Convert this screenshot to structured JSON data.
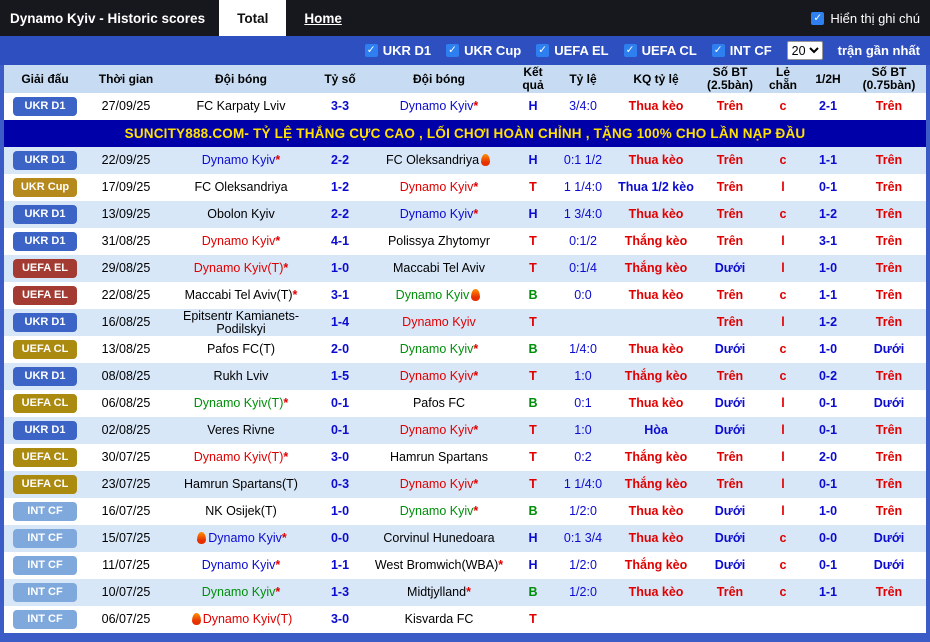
{
  "window": {
    "title": "Dynamo Kyiv - Historic scores"
  },
  "tabs": [
    {
      "label": "Total",
      "active": true
    },
    {
      "label": "Home",
      "active": false
    }
  ],
  "show_notes": {
    "label": "Hiển thị ghi chú",
    "checked": true
  },
  "filters": {
    "leagues": [
      {
        "label": "UKR D1",
        "checked": true
      },
      {
        "label": "UKR Cup",
        "checked": true
      },
      {
        "label": "UEFA EL",
        "checked": true
      },
      {
        "label": "UEFA CL",
        "checked": true
      },
      {
        "label": "INT CF",
        "checked": true
      }
    ],
    "count_value": "20",
    "count_suffix": "trận gần nhất"
  },
  "ad": {
    "text": "SUNCITY888.COM- TỶ LỆ THẮNG CỰC CAO , LỐI CHƠI HOÀN CHỈNH , TẶNG 100% CHO LẦN NẠP ĐẦU"
  },
  "colors": {
    "win_red": "#e10000",
    "draw_blue": "#0b0bd0",
    "loss_green": "#008f0a",
    "frame_blue": "#3b5cc6",
    "filter_bar_blue": "#2e4fc0",
    "header_bg": "#c7dcf2",
    "row_alt_bg": "#d8e7f8",
    "ad_bg": "#0000a8",
    "ad_text": "#ffe000",
    "leagues": {
      "ukrd1": "#3c63c6",
      "ukrcup": "#b5891b",
      "uefael": "#a43b32",
      "uefacl": "#ab8a10",
      "intcf": "#7fa9dc"
    }
  },
  "table": {
    "headers": [
      "Giải đấu",
      "Thời gian",
      "Đội bóng",
      "Tỷ số",
      "Đội bóng",
      "Kết quả",
      "Tỷ lệ",
      "KQ tỷ lệ",
      "Số BT (2.5bàn)",
      "Lẻ chẵn",
      "1/2H",
      "Số BT (0.75bàn)"
    ],
    "rows": [
      {
        "league": {
          "label": "UKR D1",
          "key": "ukrd1"
        },
        "date": "27/09/25",
        "home": {
          "name": "FC Karpaty Lviv",
          "color": "black",
          "star": false,
          "fire": null
        },
        "score": "3-3",
        "away": {
          "name": "Dynamo Kyiv",
          "color": "blue",
          "star": true,
          "fire": null
        },
        "result": {
          "text": "H",
          "color": "blue"
        },
        "handicap": "3/4:0",
        "handicap_result": {
          "text": "Thua kèo",
          "color": "red"
        },
        "goals25": {
          "text": "Trên",
          "color": "red"
        },
        "odd_even": {
          "text": "c",
          "color": "red"
        },
        "half_score": "2-1",
        "goals075": {
          "text": "Trên",
          "color": "red"
        }
      },
      {
        "league": {
          "label": "UKR D1",
          "key": "ukrd1"
        },
        "date": "22/09/25",
        "home": {
          "name": "Dynamo Kyiv",
          "color": "blue",
          "star": true,
          "fire": null
        },
        "score": "2-2",
        "away": {
          "name": "FC Oleksandriya",
          "color": "black",
          "star": false,
          "fire": "after"
        },
        "result": {
          "text": "H",
          "color": "blue"
        },
        "handicap": "0:1 1/2",
        "handicap_result": {
          "text": "Thua kèo",
          "color": "red"
        },
        "goals25": {
          "text": "Trên",
          "color": "red"
        },
        "odd_even": {
          "text": "c",
          "color": "red"
        },
        "half_score": "1-1",
        "goals075": {
          "text": "Trên",
          "color": "red"
        }
      },
      {
        "league": {
          "label": "UKR Cup",
          "key": "ukrcup"
        },
        "date": "17/09/25",
        "home": {
          "name": "FC Oleksandriya",
          "color": "black",
          "star": false,
          "fire": null
        },
        "score": "1-2",
        "away": {
          "name": "Dynamo Kyiv",
          "color": "red",
          "star": true,
          "fire": null
        },
        "result": {
          "text": "T",
          "color": "red"
        },
        "handicap": "1 1/4:0",
        "handicap_result": {
          "text": "Thua 1/2 kèo",
          "color": "blue"
        },
        "goals25": {
          "text": "Trên",
          "color": "red"
        },
        "odd_even": {
          "text": "l",
          "color": "red"
        },
        "half_score": "0-1",
        "goals075": {
          "text": "Trên",
          "color": "red"
        }
      },
      {
        "league": {
          "label": "UKR D1",
          "key": "ukrd1"
        },
        "date": "13/09/25",
        "home": {
          "name": "Obolon Kyiv",
          "color": "black",
          "star": false,
          "fire": null
        },
        "score": "2-2",
        "away": {
          "name": "Dynamo Kyiv",
          "color": "blue",
          "star": true,
          "fire": null
        },
        "result": {
          "text": "H",
          "color": "blue"
        },
        "handicap": "1 3/4:0",
        "handicap_result": {
          "text": "Thua kèo",
          "color": "red"
        },
        "goals25": {
          "text": "Trên",
          "color": "red"
        },
        "odd_even": {
          "text": "c",
          "color": "red"
        },
        "half_score": "1-2",
        "goals075": {
          "text": "Trên",
          "color": "red"
        }
      },
      {
        "league": {
          "label": "UKR D1",
          "key": "ukrd1"
        },
        "date": "31/08/25",
        "home": {
          "name": "Dynamo Kyiv",
          "color": "red",
          "star": true,
          "fire": null
        },
        "score": "4-1",
        "away": {
          "name": "Polissya Zhytomyr",
          "color": "black",
          "star": false,
          "fire": null
        },
        "result": {
          "text": "T",
          "color": "red"
        },
        "handicap": "0:1/2",
        "handicap_result": {
          "text": "Thắng kèo",
          "color": "red"
        },
        "goals25": {
          "text": "Trên",
          "color": "red"
        },
        "odd_even": {
          "text": "l",
          "color": "red"
        },
        "half_score": "3-1",
        "goals075": {
          "text": "Trên",
          "color": "red"
        }
      },
      {
        "league": {
          "label": "UEFA EL",
          "key": "uefael"
        },
        "date": "29/08/25",
        "home": {
          "name": "Dynamo Kyiv(T)",
          "color": "red",
          "star": true,
          "fire": null
        },
        "score": "1-0",
        "away": {
          "name": "Maccabi Tel Aviv",
          "color": "black",
          "star": false,
          "fire": null
        },
        "result": {
          "text": "T",
          "color": "red"
        },
        "handicap": "0:1/4",
        "handicap_result": {
          "text": "Thắng kèo",
          "color": "red"
        },
        "goals25": {
          "text": "Dưới",
          "color": "blue"
        },
        "odd_even": {
          "text": "l",
          "color": "red"
        },
        "half_score": "1-0",
        "goals075": {
          "text": "Trên",
          "color": "red"
        }
      },
      {
        "league": {
          "label": "UEFA EL",
          "key": "uefael"
        },
        "date": "22/08/25",
        "home": {
          "name": "Maccabi Tel Aviv(T)",
          "color": "black",
          "star": true,
          "fire": null
        },
        "score": "3-1",
        "away": {
          "name": "Dynamo Kyiv",
          "color": "green",
          "star": false,
          "fire": "after"
        },
        "result": {
          "text": "B",
          "color": "green"
        },
        "handicap": "0:0",
        "handicap_result": {
          "text": "Thua kèo",
          "color": "red"
        },
        "goals25": {
          "text": "Trên",
          "color": "red"
        },
        "odd_even": {
          "text": "c",
          "color": "red"
        },
        "half_score": "1-1",
        "goals075": {
          "text": "Trên",
          "color": "red"
        }
      },
      {
        "league": {
          "label": "UKR D1",
          "key": "ukrd1"
        },
        "date": "16/08/25",
        "home": {
          "name": "Epitsentr Kamianets-Podilskyi",
          "color": "black",
          "star": false,
          "fire": null
        },
        "score": "1-4",
        "away": {
          "name": "Dynamo Kyiv",
          "color": "red",
          "star": false,
          "fire": null
        },
        "result": {
          "text": "T",
          "color": "red"
        },
        "handicap": "",
        "handicap_result": {
          "text": "",
          "color": "red"
        },
        "goals25": {
          "text": "Trên",
          "color": "red"
        },
        "odd_even": {
          "text": "l",
          "color": "red"
        },
        "half_score": "1-2",
        "goals075": {
          "text": "Trên",
          "color": "red"
        }
      },
      {
        "league": {
          "label": "UEFA CL",
          "key": "uefacl"
        },
        "date": "13/08/25",
        "home": {
          "name": "Pafos FC(T)",
          "color": "black",
          "star": false,
          "fire": null
        },
        "score": "2-0",
        "away": {
          "name": "Dynamo Kyiv",
          "color": "green",
          "star": true,
          "fire": null
        },
        "result": {
          "text": "B",
          "color": "green"
        },
        "handicap": "1/4:0",
        "handicap_result": {
          "text": "Thua kèo",
          "color": "red"
        },
        "goals25": {
          "text": "Dưới",
          "color": "blue"
        },
        "odd_even": {
          "text": "c",
          "color": "red"
        },
        "half_score": "1-0",
        "goals075": {
          "text": "Dưới",
          "color": "blue"
        }
      },
      {
        "league": {
          "label": "UKR D1",
          "key": "ukrd1"
        },
        "date": "08/08/25",
        "home": {
          "name": "Rukh Lviv",
          "color": "black",
          "star": false,
          "fire": null
        },
        "score": "1-5",
        "away": {
          "name": "Dynamo Kyiv",
          "color": "red",
          "star": true,
          "fire": null
        },
        "result": {
          "text": "T",
          "color": "red"
        },
        "handicap": "1:0",
        "handicap_result": {
          "text": "Thắng kèo",
          "color": "red"
        },
        "goals25": {
          "text": "Trên",
          "color": "red"
        },
        "odd_even": {
          "text": "c",
          "color": "red"
        },
        "half_score": "0-2",
        "goals075": {
          "text": "Trên",
          "color": "red"
        }
      },
      {
        "league": {
          "label": "UEFA CL",
          "key": "uefacl"
        },
        "date": "06/08/25",
        "home": {
          "name": "Dynamo Kyiv(T)",
          "color": "green",
          "star": true,
          "fire": null
        },
        "score": "0-1",
        "away": {
          "name": "Pafos FC",
          "color": "black",
          "star": false,
          "fire": null
        },
        "result": {
          "text": "B",
          "color": "green"
        },
        "handicap": "0:1",
        "handicap_result": {
          "text": "Thua kèo",
          "color": "red"
        },
        "goals25": {
          "text": "Dưới",
          "color": "blue"
        },
        "odd_even": {
          "text": "l",
          "color": "red"
        },
        "half_score": "0-1",
        "goals075": {
          "text": "Dưới",
          "color": "blue"
        }
      },
      {
        "league": {
          "label": "UKR D1",
          "key": "ukrd1"
        },
        "date": "02/08/25",
        "home": {
          "name": "Veres Rivne",
          "color": "black",
          "star": false,
          "fire": null
        },
        "score": "0-1",
        "away": {
          "name": "Dynamo Kyiv",
          "color": "red",
          "star": true,
          "fire": null
        },
        "result": {
          "text": "T",
          "color": "red"
        },
        "handicap": "1:0",
        "handicap_result": {
          "text": "Hòa",
          "color": "blue"
        },
        "goals25": {
          "text": "Dưới",
          "color": "blue"
        },
        "odd_even": {
          "text": "l",
          "color": "red"
        },
        "half_score": "0-1",
        "goals075": {
          "text": "Trên",
          "color": "red"
        }
      },
      {
        "league": {
          "label": "UEFA CL",
          "key": "uefacl"
        },
        "date": "30/07/25",
        "home": {
          "name": "Dynamo Kyiv(T)",
          "color": "red",
          "star": true,
          "fire": null
        },
        "score": "3-0",
        "away": {
          "name": "Hamrun Spartans",
          "color": "black",
          "star": false,
          "fire": null
        },
        "result": {
          "text": "T",
          "color": "red"
        },
        "handicap": "0:2",
        "handicap_result": {
          "text": "Thắng kèo",
          "color": "red"
        },
        "goals25": {
          "text": "Trên",
          "color": "red"
        },
        "odd_even": {
          "text": "l",
          "color": "red"
        },
        "half_score": "2-0",
        "goals075": {
          "text": "Trên",
          "color": "red"
        }
      },
      {
        "league": {
          "label": "UEFA CL",
          "key": "uefacl"
        },
        "date": "23/07/25",
        "home": {
          "name": "Hamrun Spartans(T)",
          "color": "black",
          "star": false,
          "fire": null
        },
        "score": "0-3",
        "away": {
          "name": "Dynamo Kyiv",
          "color": "red",
          "star": true,
          "fire": null
        },
        "result": {
          "text": "T",
          "color": "red"
        },
        "handicap": "1 1/4:0",
        "handicap_result": {
          "text": "Thắng kèo",
          "color": "red"
        },
        "goals25": {
          "text": "Trên",
          "color": "red"
        },
        "odd_even": {
          "text": "l",
          "color": "red"
        },
        "half_score": "0-1",
        "goals075": {
          "text": "Trên",
          "color": "red"
        }
      },
      {
        "league": {
          "label": "INT CF",
          "key": "intcf"
        },
        "date": "16/07/25",
        "home": {
          "name": "NK Osijek(T)",
          "color": "black",
          "star": false,
          "fire": null
        },
        "score": "1-0",
        "away": {
          "name": "Dynamo Kyiv",
          "color": "green",
          "star": true,
          "fire": null
        },
        "result": {
          "text": "B",
          "color": "green"
        },
        "handicap": "1/2:0",
        "handicap_result": {
          "text": "Thua kèo",
          "color": "red"
        },
        "goals25": {
          "text": "Dưới",
          "color": "blue"
        },
        "odd_even": {
          "text": "l",
          "color": "red"
        },
        "half_score": "1-0",
        "goals075": {
          "text": "Trên",
          "color": "red"
        }
      },
      {
        "league": {
          "label": "INT CF",
          "key": "intcf"
        },
        "date": "15/07/25",
        "home": {
          "name": "Dynamo Kyiv",
          "color": "blue",
          "star": true,
          "fire": "before"
        },
        "score": "0-0",
        "away": {
          "name": "Corvinul Hunedoara",
          "color": "black",
          "star": false,
          "fire": null
        },
        "result": {
          "text": "H",
          "color": "blue"
        },
        "handicap": "0:1 3/4",
        "handicap_result": {
          "text": "Thua kèo",
          "color": "red"
        },
        "goals25": {
          "text": "Dưới",
          "color": "blue"
        },
        "odd_even": {
          "text": "c",
          "color": "red"
        },
        "half_score": "0-0",
        "goals075": {
          "text": "Dưới",
          "color": "blue"
        }
      },
      {
        "league": {
          "label": "INT CF",
          "key": "intcf"
        },
        "date": "11/07/25",
        "home": {
          "name": "Dynamo Kyiv",
          "color": "blue",
          "star": true,
          "fire": null
        },
        "score": "1-1",
        "away": {
          "name": "West Bromwich(WBA)",
          "color": "black",
          "star": true,
          "fire": null
        },
        "result": {
          "text": "H",
          "color": "blue"
        },
        "handicap": "1/2:0",
        "handicap_result": {
          "text": "Thắng kèo",
          "color": "red"
        },
        "goals25": {
          "text": "Dưới",
          "color": "blue"
        },
        "odd_even": {
          "text": "c",
          "color": "red"
        },
        "half_score": "0-1",
        "goals075": {
          "text": "Dưới",
          "color": "blue"
        }
      },
      {
        "league": {
          "label": "INT CF",
          "key": "intcf"
        },
        "date": "10/07/25",
        "home": {
          "name": "Dynamo Kyiv",
          "color": "green",
          "star": true,
          "fire": null
        },
        "score": "1-3",
        "away": {
          "name": "Midtjylland",
          "color": "black",
          "star": true,
          "fire": null
        },
        "result": {
          "text": "B",
          "color": "green"
        },
        "handicap": "1/2:0",
        "handicap_result": {
          "text": "Thua kèo",
          "color": "red"
        },
        "goals25": {
          "text": "Trên",
          "color": "red"
        },
        "odd_even": {
          "text": "c",
          "color": "red"
        },
        "half_score": "1-1",
        "goals075": {
          "text": "Trên",
          "color": "red"
        }
      },
      {
        "league": {
          "label": "INT CF",
          "key": "intcf"
        },
        "date": "06/07/25",
        "home": {
          "name": "Dynamo Kyiv(T)",
          "color": "red",
          "star": false,
          "fire": "before"
        },
        "score": "3-0",
        "away": {
          "name": "Kisvarda FC",
          "color": "black",
          "star": false,
          "fire": null
        },
        "result": {
          "text": "T",
          "color": "red"
        },
        "handicap": "",
        "handicap_result": {
          "text": "",
          "color": "red"
        },
        "goals25": {
          "text": "",
          "color": "red"
        },
        "odd_even": {
          "text": "",
          "color": "red"
        },
        "half_score": "",
        "goals075": {
          "text": "",
          "color": "red"
        }
      }
    ]
  }
}
